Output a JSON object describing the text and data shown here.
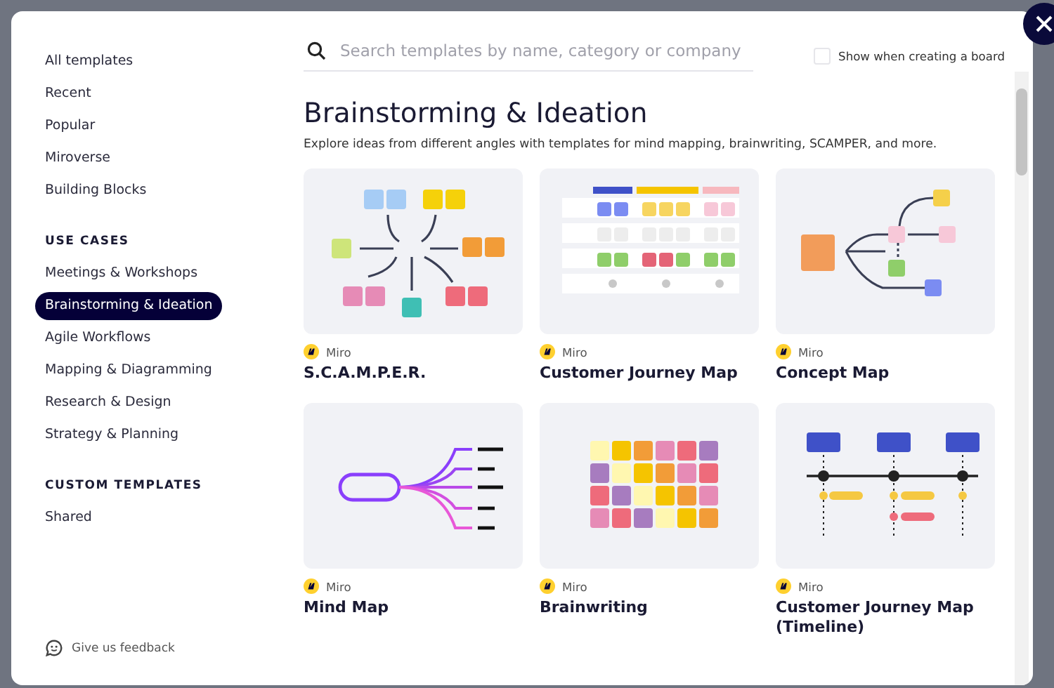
{
  "sidebar": {
    "items": [
      {
        "label": "All templates",
        "selected": false
      },
      {
        "label": "Recent",
        "selected": false
      },
      {
        "label": "Popular",
        "selected": false
      },
      {
        "label": "Miroverse",
        "selected": false
      },
      {
        "label": "Building Blocks",
        "selected": false
      }
    ],
    "sections": [
      {
        "heading": "USE CASES",
        "items": [
          {
            "label": "Meetings & Workshops",
            "selected": false
          },
          {
            "label": "Brainstorming & Ideation",
            "selected": true
          },
          {
            "label": "Agile Workflows",
            "selected": false
          },
          {
            "label": "Mapping & Diagramming",
            "selected": false
          },
          {
            "label": "Research & Design",
            "selected": false
          },
          {
            "label": "Strategy & Planning",
            "selected": false
          }
        ]
      },
      {
        "heading": "CUSTOM TEMPLATES",
        "items": [
          {
            "label": "Shared",
            "selected": false
          }
        ]
      }
    ],
    "feedback": "Give us feedback"
  },
  "search": {
    "placeholder": "Search templates by name, category or company"
  },
  "show_when_creating": {
    "label": "Show when creating a board",
    "checked": false
  },
  "heading": "Brainstorming & Ideation",
  "description": "Explore ideas from different angles with templates for mind mapping, brainwriting, SCAMPER, and more.",
  "templates": [
    {
      "kind": "scamper",
      "author": "Miro",
      "title": "S.C.A.M.P.E.R."
    },
    {
      "kind": "journey",
      "author": "Miro",
      "title": "Customer Journey Map"
    },
    {
      "kind": "concept",
      "author": "Miro",
      "title": "Concept Map"
    },
    {
      "kind": "mindmap",
      "author": "Miro",
      "title": "Mind Map"
    },
    {
      "kind": "brainwriting",
      "author": "Miro",
      "title": "Brainwriting"
    },
    {
      "kind": "timeline",
      "author": "Miro",
      "title": "Customer Journey Map (Timeline)"
    }
  ]
}
